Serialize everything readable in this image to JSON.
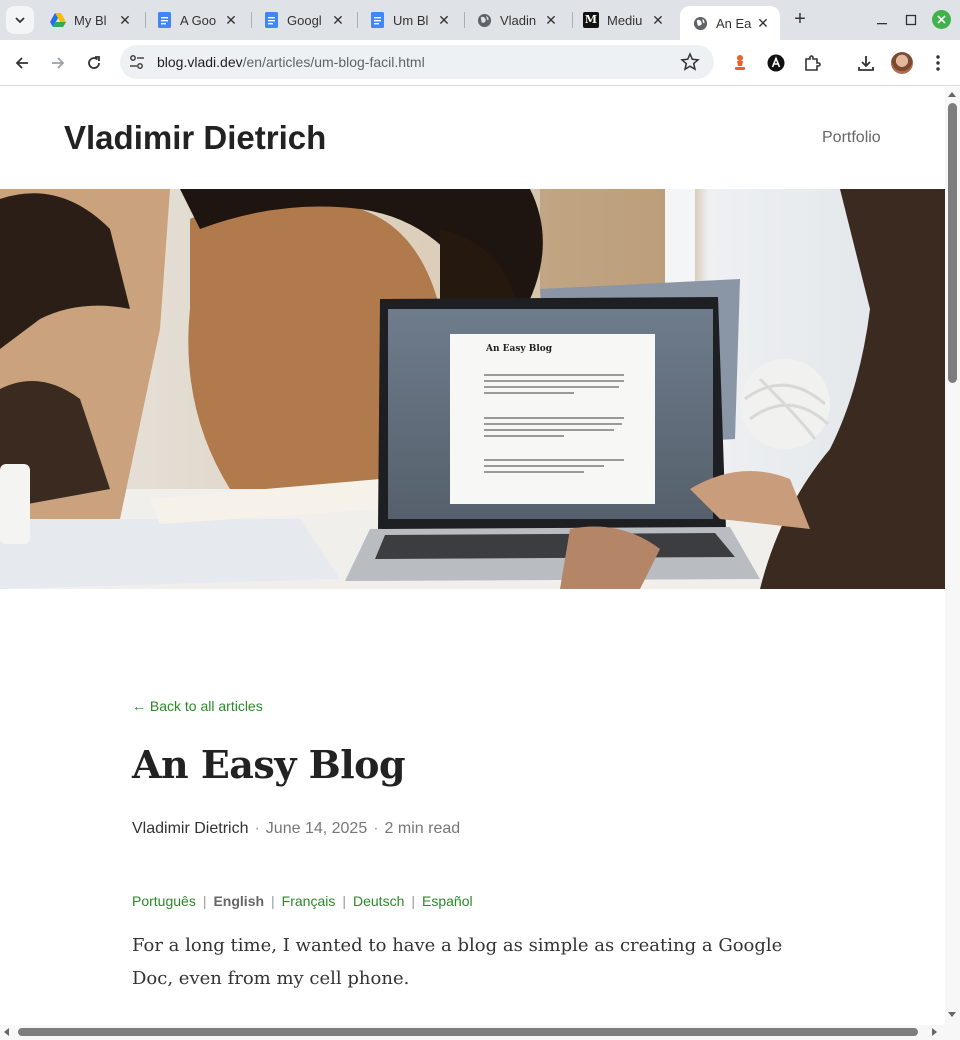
{
  "browser": {
    "tabs": [
      {
        "title": "My Bl",
        "icon": "google-drive-icon"
      },
      {
        "title": "A Goo",
        "icon": "google-docs-icon"
      },
      {
        "title": "Googl",
        "icon": "google-docs-icon"
      },
      {
        "title": "Um Bl",
        "icon": "google-docs-icon"
      },
      {
        "title": "Vladin",
        "icon": "globe-icon"
      },
      {
        "title": "Mediu",
        "icon": "medium-icon"
      },
      {
        "title": "An Ea",
        "icon": "globe-icon",
        "active": true
      }
    ],
    "medium_icon_text": "M",
    "new_tab_label": "+",
    "close_tab_label": "✕",
    "url_host": "blog.vladi.dev",
    "url_path": "/en/articles/um-blog-facil.html"
  },
  "site": {
    "title": "Vladimir Dietrich",
    "nav_portfolio": "Portfolio"
  },
  "hero": {
    "laptop_doc_title": "An Easy Blog"
  },
  "article": {
    "back_link": "← Back to all articles",
    "title": "An Easy Blog",
    "author": "Vladimir Dietrich",
    "separator": "·",
    "date": "June 14, 2025",
    "read_time": "2 min read",
    "languages": [
      {
        "label": "Português",
        "current": false
      },
      {
        "label": "English",
        "current": true
      },
      {
        "label": "Français",
        "current": false
      },
      {
        "label": "Deutsch",
        "current": false
      },
      {
        "label": "Español",
        "current": false
      }
    ],
    "language_separator": "|",
    "intro": "For a long time, I wanted to have a blog as simple as creating a Google Doc, even from my cell phone."
  },
  "colors": {
    "link_green": "#2a8a2a",
    "tabstrip_bg": "#dfe3e8",
    "text_dark": "#222222"
  }
}
